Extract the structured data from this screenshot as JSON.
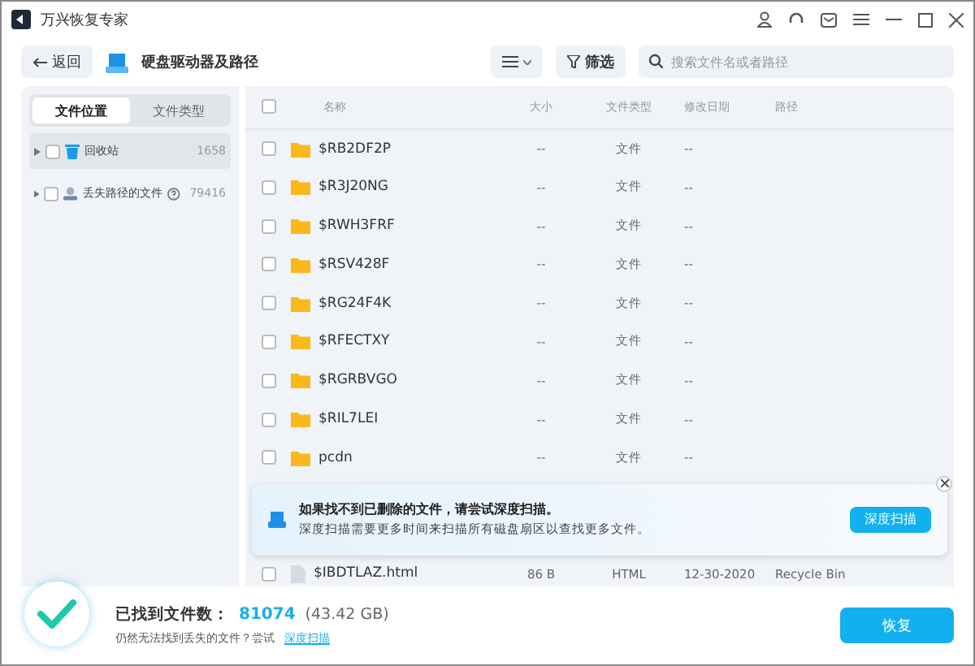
{
  "window": {
    "title": "万兴恢复专家"
  },
  "toolbar": {
    "back": "返回",
    "location": "硬盘驱动器及路径",
    "filter": "筛选",
    "search_placeholder": "搜索文件名或者路径"
  },
  "side_tabs": [
    {
      "label": "文件位置",
      "selected": true
    },
    {
      "label": "文件类型",
      "selected": false
    }
  ],
  "tree": [
    {
      "label": "回收站",
      "count": "1658",
      "kind": "trash",
      "selected": true,
      "help": false,
      "checked": false
    },
    {
      "label": "丢失路径的文件",
      "count": "79416",
      "kind": "lost",
      "selected": false,
      "help": true,
      "checked": false
    }
  ],
  "table": {
    "select_all_checked": false,
    "columns": [
      "名称",
      "大小",
      "文件类型",
      "修改日期",
      "路径"
    ],
    "rows": [
      {
        "name": "$RB2DF2P",
        "size": "--",
        "type": "文件",
        "date": "--",
        "path": "",
        "kind": "folder",
        "checked": false
      },
      {
        "name": "$R3J20NG",
        "size": "--",
        "type": "文件",
        "date": "--",
        "path": "",
        "kind": "folder",
        "checked": false
      },
      {
        "name": "$RWH3FRF",
        "size": "--",
        "type": "文件",
        "date": "--",
        "path": "",
        "kind": "folder",
        "checked": false
      },
      {
        "name": "$RSV428F",
        "size": "--",
        "type": "文件",
        "date": "--",
        "path": "",
        "kind": "folder",
        "checked": false
      },
      {
        "name": "$RG24F4K",
        "size": "--",
        "type": "文件",
        "date": "--",
        "path": "",
        "kind": "folder",
        "checked": false
      },
      {
        "name": "$RFECTXY",
        "size": "--",
        "type": "文件",
        "date": "--",
        "path": "",
        "kind": "folder",
        "checked": false
      },
      {
        "name": "$RGRBVGO",
        "size": "--",
        "type": "文件",
        "date": "--",
        "path": "",
        "kind": "folder",
        "checked": false
      },
      {
        "name": "$RIL7LEI",
        "size": "--",
        "type": "文件",
        "date": "--",
        "path": "",
        "kind": "folder",
        "checked": false
      },
      {
        "name": "pcdn",
        "size": "--",
        "type": "文件",
        "date": "--",
        "path": "",
        "kind": "folder",
        "checked": false
      },
      {
        "name": "$IBDTLAZ.html",
        "size": "86 B",
        "type": "HTML",
        "date": "12-30-2020",
        "path": "Recycle Bin",
        "kind": "file",
        "checked": false
      }
    ]
  },
  "banner": {
    "title": "如果找不到已删除的文件，请尝试深度扫描。",
    "text": "深度扫描需要更多时间来扫描所有磁盘扇区以查找更多文件。",
    "button": "深度扫描"
  },
  "footer": {
    "found_label": "已找到文件数：",
    "count": "81074",
    "size": "(43.42 GB)",
    "hint": "仍然无法找到丢失的文件？尝试",
    "link": "深度扫描",
    "recover": "恢复"
  }
}
